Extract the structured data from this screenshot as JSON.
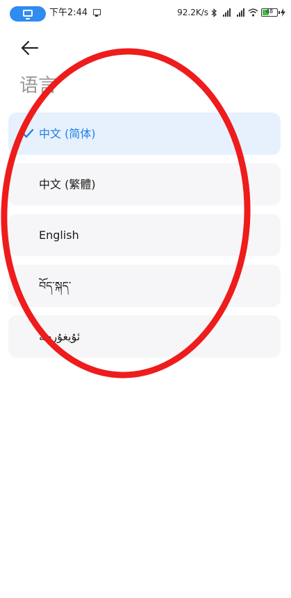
{
  "status_bar": {
    "time": "下午2:44",
    "net_speed": "92.2K/s",
    "battery_level": "48",
    "battery_fill_fraction": 0.48,
    "icons": [
      "screen-cast-icon",
      "notification-icon",
      "bluetooth-icon",
      "signal-hd-icon",
      "wifi-icon",
      "battery-icon",
      "charging-icon"
    ]
  },
  "header": {
    "back_icon": "back-arrow-icon",
    "title": "语言"
  },
  "languages": [
    {
      "label": "中文 (简体)",
      "selected": true
    },
    {
      "label": "中文 (繁體)",
      "selected": false
    },
    {
      "label": "English",
      "selected": false
    },
    {
      "label": "བོད་སྐད་",
      "selected": false
    },
    {
      "label": "ئۇيغۇرچە",
      "selected": false
    }
  ],
  "colors": {
    "accent": "#1f7fe5",
    "cast_pill": "#2f8cf0",
    "selected_bg": "#e6f1fd",
    "item_bg": "#f6f6f8",
    "title": "#9a9a9a",
    "annotation": "#ee1c1c",
    "battery": "#44c04a"
  }
}
